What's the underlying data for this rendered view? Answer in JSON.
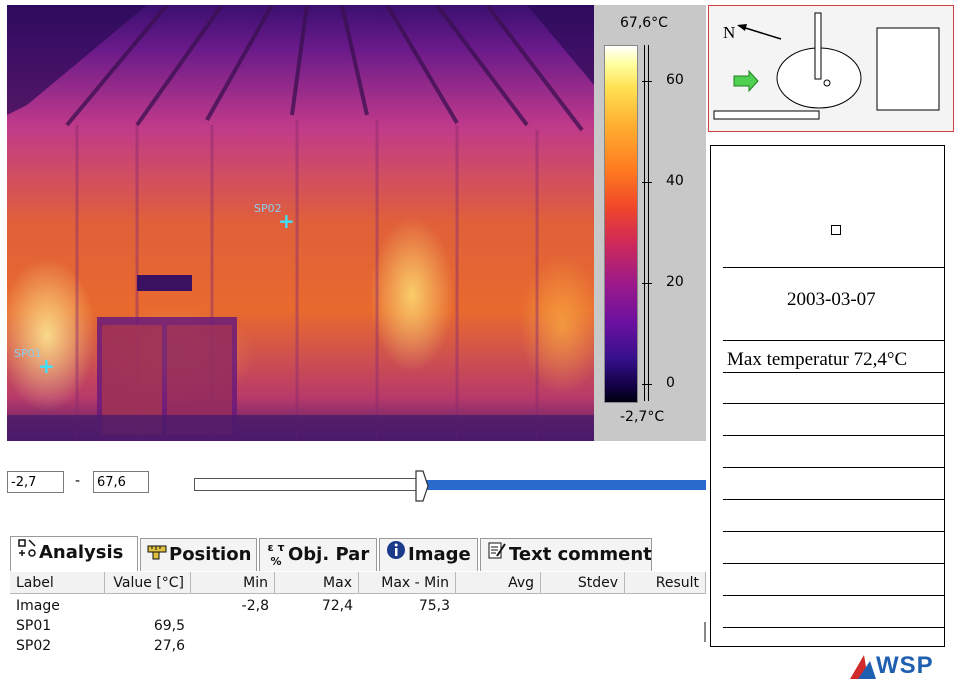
{
  "thermal": {
    "spots": [
      {
        "label": "SP01"
      },
      {
        "label": "SP02"
      }
    ]
  },
  "colorbar": {
    "max_label": "67,6°C",
    "min_label": "-2,7°C",
    "ticks": [
      "60",
      "40",
      "20",
      "0"
    ]
  },
  "range": {
    "low_value": "-2,7",
    "separator": "-",
    "high_value": "67,6"
  },
  "tabs": [
    {
      "label": "Analysis",
      "icon": "analysis-icon",
      "active": true
    },
    {
      "label": "Position",
      "icon": "ruler-icon",
      "active": false
    },
    {
      "label": "Obj. Par",
      "icon": "object-params-icon",
      "active": false
    },
    {
      "label": "Image",
      "icon": "info-icon",
      "active": false
    },
    {
      "label": "Text comment",
      "icon": "comment-edit-icon",
      "active": false
    }
  ],
  "table": {
    "headers": [
      "Label",
      "Value [°C]",
      "Min",
      "Max",
      "Max - Min",
      "Avg",
      "Stdev",
      "Result"
    ],
    "rows": [
      {
        "label": "Image",
        "value": "",
        "min": "-2,8",
        "max": "72,4",
        "range": "75,3"
      },
      {
        "label": "SP01",
        "value": "69,5",
        "min": "",
        "max": "",
        "range": ""
      },
      {
        "label": "SP02",
        "value": "27,6",
        "min": "",
        "max": "",
        "range": ""
      }
    ]
  },
  "map": {
    "north_label": "N"
  },
  "notes": {
    "date": "2003-03-07",
    "max_temp": "Max temperatur 72,4°C"
  },
  "logo": {
    "text": "WSP"
  },
  "colors": {
    "map_border": "#d04040",
    "slider_fill": "#2a6acc",
    "spot_marker": "#40e0ff",
    "logo_blue": "#1f5fb0",
    "logo_red": "#d02a2a"
  }
}
